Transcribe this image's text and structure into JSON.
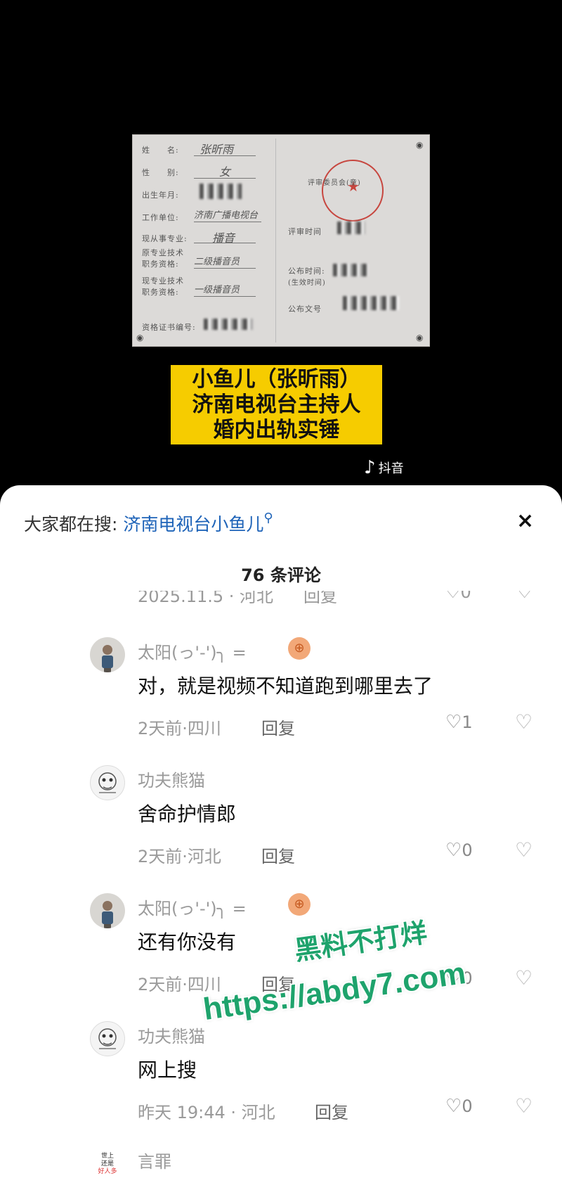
{
  "video": {
    "certificate": {
      "fields": [
        {
          "label": "姓　　名:",
          "value": "张昕雨"
        },
        {
          "label": "性　　别:",
          "value": "女"
        },
        {
          "label": "出生年月:",
          "value": ""
        },
        {
          "label": "工作单位:",
          "value": "济南广播电视台"
        },
        {
          "label": "现从事专业:",
          "value": "播音"
        },
        {
          "label": "原专业技术",
          "value": ""
        },
        {
          "label": "职务资格:",
          "value": "二级播音员"
        },
        {
          "label": "现专业技术",
          "value": ""
        },
        {
          "label": "职务资格:",
          "value": "一级播音员"
        },
        {
          "label": "资格证书编号:",
          "value": ""
        }
      ],
      "right_labels": [
        "评审委员会(章)",
        "评审时间",
        "公布时间:",
        "(生效时间)",
        "公布文号"
      ]
    },
    "caption_lines": [
      "小鱼儿（张昕雨）",
      "济南电视台主持人",
      "婚内出轨实锤"
    ],
    "platform_label": "抖音",
    "platform_logo": "tiktok-note-icon"
  },
  "sheet": {
    "search_lead": "大家都在搜:",
    "search_term": "济南电视台小鱼儿",
    "search_icon": "search-icon",
    "close_glyph": "×",
    "comment_count": "76 条评论",
    "partial_row": {
      "meta": "2025.11.5 · 河北",
      "reply": "回复",
      "likes": "0"
    },
    "comments": [
      {
        "user": "太阳(っ'-')╮ =",
        "text": "对，就是视频不知道跑到哪里去了",
        "meta": "2天前·四川",
        "reply": "回复",
        "likes": "1",
        "badge": "basketball-icon"
      },
      {
        "user": "功夫熊猫",
        "text": "舍命护情郎",
        "meta": "2天前·河北",
        "reply": "回复",
        "likes": "0"
      },
      {
        "user": "太阳(っ'-')╮ =",
        "text": "还有你没有",
        "meta": "2天前·四川",
        "reply": "回复",
        "likes": "0",
        "badge": "basketball-icon"
      },
      {
        "user": "功夫熊猫",
        "text": "网上搜",
        "meta": "昨天 19:44 · 河北",
        "reply": "回复",
        "likes": "0"
      },
      {
        "user": "言罪",
        "text": "",
        "avatar_text": [
          "世上",
          "还是",
          "好人多"
        ]
      }
    ]
  },
  "watermark": {
    "line1": "黑料不打烊",
    "line2": "https://abdy7.com"
  }
}
